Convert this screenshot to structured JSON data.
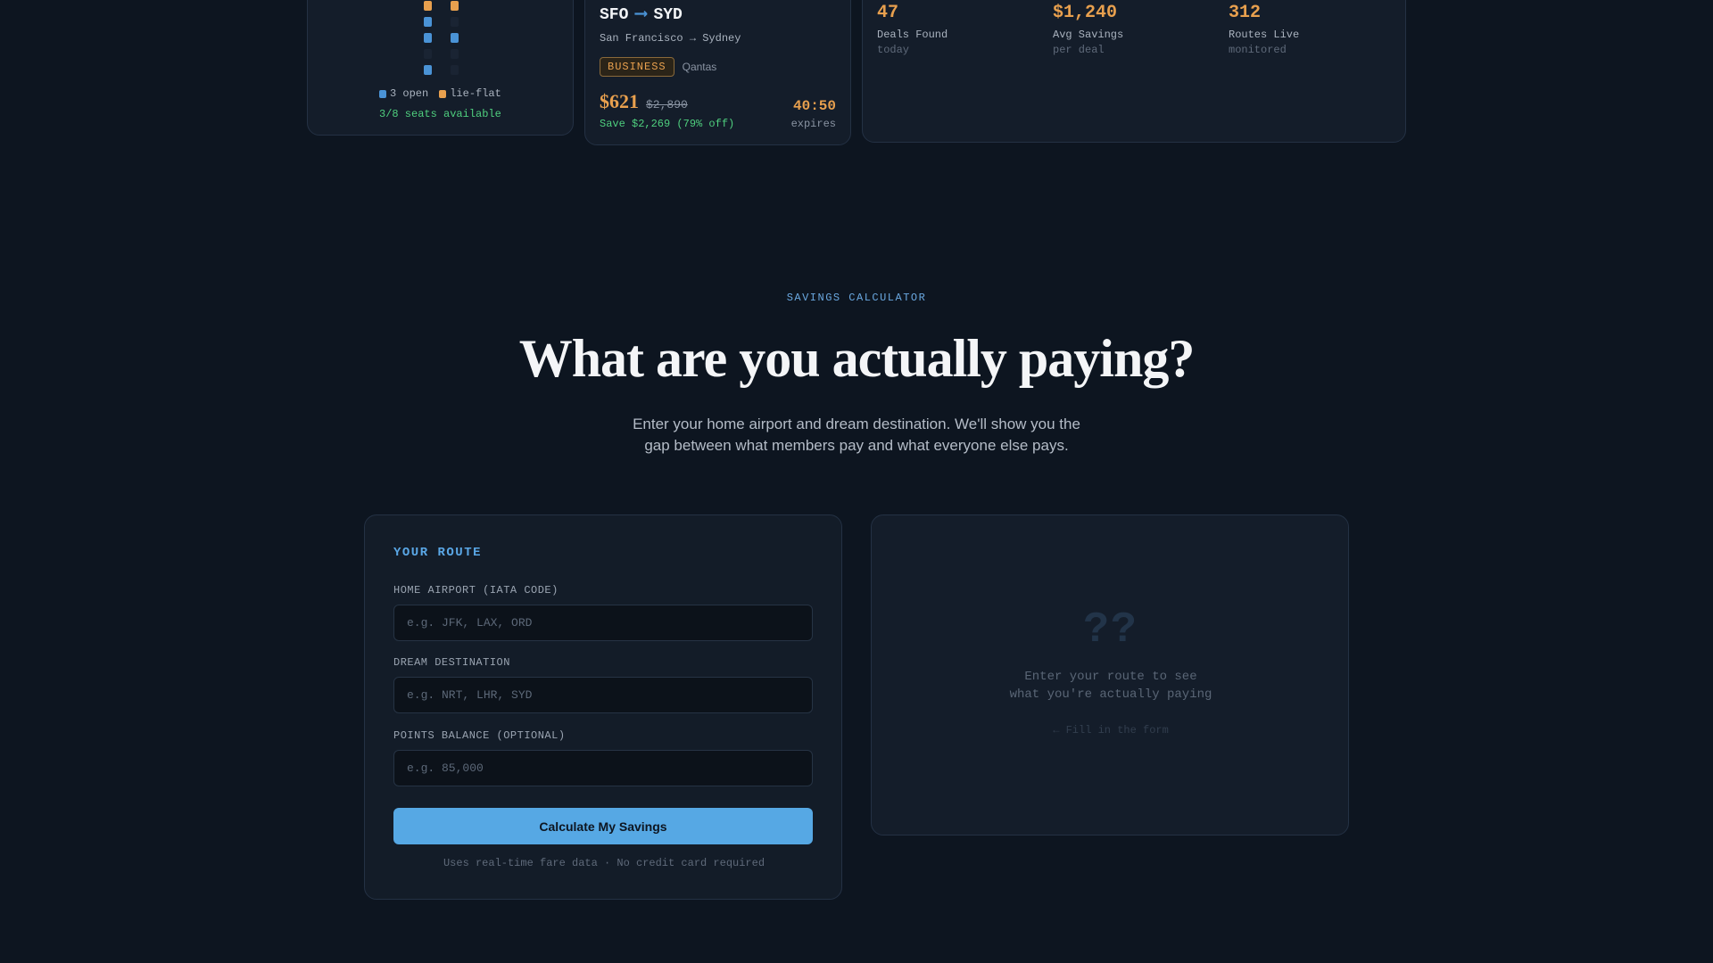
{
  "seat_map": {
    "legend_open": "3 open",
    "legend_lieflat": "lie-flat",
    "availability": "3/8 seats available"
  },
  "deal": {
    "origin": "SFO",
    "destination": "SYD",
    "route_full": "San Francisco → Sydney",
    "cabin_class": "BUSINESS",
    "airline": "Qantas",
    "price": "$621",
    "original_price": "$2,890",
    "savings": "Save $2,269 (79% off)",
    "timer": "40:50",
    "timer_label": "expires"
  },
  "stats": [
    {
      "value": "47",
      "label": "Deals Found",
      "sub": "today"
    },
    {
      "value": "$1,240",
      "label": "Avg Savings",
      "sub": "per deal"
    },
    {
      "value": "312",
      "label": "Routes Live",
      "sub": "monitored"
    }
  ],
  "calculator": {
    "eyebrow": "SAVINGS CALCULATOR",
    "headline": "What are you actually paying?",
    "subhead": "Enter your home airport and dream destination. We'll show you the gap between what members pay and what everyone else pays."
  },
  "form": {
    "title": "YOUR ROUTE",
    "home_label": "HOME AIRPORT (IATA CODE)",
    "home_placeholder": "e.g. JFK, LAX, ORD",
    "home_value": "",
    "dest_label": "DREAM DESTINATION",
    "dest_placeholder": "e.g. NRT, LHR, SYD",
    "dest_value": "",
    "points_label": "POINTS BALANCE (OPTIONAL)",
    "points_placeholder": "e.g. 85,000",
    "points_value": "",
    "button": "Calculate My Savings",
    "note": "Uses real-time fare data · No credit card required"
  },
  "result": {
    "symbol": "??",
    "line1": "Enter your route to see",
    "line2": "what you're actually paying",
    "hint": "← Fill in the form"
  },
  "colors": {
    "background": "#0d1520",
    "accent_blue": "#56a8e4",
    "accent_orange": "#e8a04e",
    "success_green": "#4fcf7e"
  }
}
